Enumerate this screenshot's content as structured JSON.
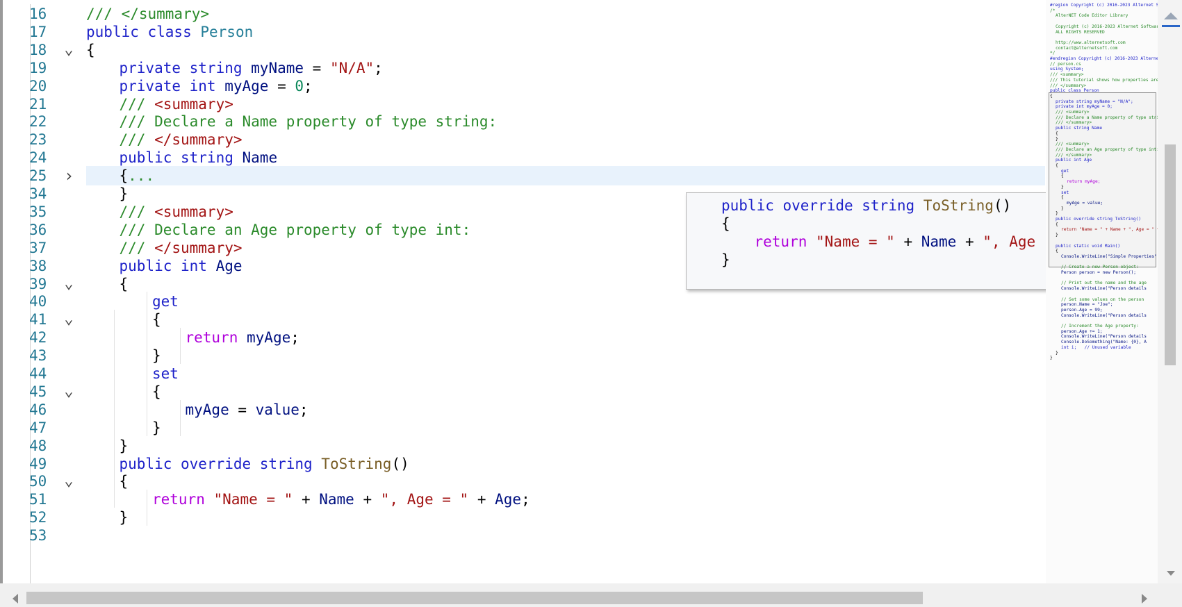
{
  "editor": {
    "lines": [
      {
        "num": "16",
        "fold": "",
        "indent": 0,
        "tokens": [
          {
            "t": "/// </summary>",
            "c": "cm"
          }
        ]
      },
      {
        "num": "17",
        "fold": "",
        "indent": 0,
        "tokens": [
          {
            "t": "public class ",
            "c": "kw"
          },
          {
            "t": "Person",
            "c": "ty"
          }
        ]
      },
      {
        "num": "18",
        "fold": "v",
        "indent": 0,
        "tokens": [
          {
            "t": "{",
            "c": "plain"
          }
        ]
      },
      {
        "num": "19",
        "fold": "",
        "indent": 1,
        "tokens": [
          {
            "t": "private string ",
            "c": "kw"
          },
          {
            "t": "myName",
            "c": "id"
          },
          {
            "t": " = ",
            "c": "plain"
          },
          {
            "t": "\"N/A\"",
            "c": "str"
          },
          {
            "t": ";",
            "c": "plain"
          }
        ]
      },
      {
        "num": "20",
        "fold": "",
        "indent": 1,
        "tokens": [
          {
            "t": "private int ",
            "c": "kw"
          },
          {
            "t": "myAge",
            "c": "id"
          },
          {
            "t": " = ",
            "c": "plain"
          },
          {
            "t": "0",
            "c": "num"
          },
          {
            "t": ";",
            "c": "plain"
          }
        ]
      },
      {
        "num": "21",
        "fold": "",
        "indent": 1,
        "tokens": [
          {
            "t": "/// ",
            "c": "cm"
          },
          {
            "t": "<summary>",
            "c": "str"
          }
        ]
      },
      {
        "num": "22",
        "fold": "",
        "indent": 1,
        "tokens": [
          {
            "t": "/// Declare a Name property of type string:",
            "c": "cm"
          }
        ]
      },
      {
        "num": "23",
        "fold": "",
        "indent": 1,
        "tokens": [
          {
            "t": "/// ",
            "c": "cm"
          },
          {
            "t": "</summary>",
            "c": "str"
          }
        ]
      },
      {
        "num": "24",
        "fold": "",
        "indent": 1,
        "tokens": [
          {
            "t": "public string ",
            "c": "kw"
          },
          {
            "t": "Name",
            "c": "id"
          }
        ]
      },
      {
        "num": "25",
        "fold": ">",
        "indent": 1,
        "highlight": true,
        "tokens": [
          {
            "t": "{",
            "c": "plain"
          },
          {
            "t": "...",
            "c": "cm"
          }
        ]
      },
      {
        "num": "34",
        "fold": "",
        "indent": 1,
        "tokens": [
          {
            "t": "}",
            "c": "plain"
          }
        ]
      },
      {
        "num": "35",
        "fold": "",
        "indent": 1,
        "tokens": [
          {
            "t": "/// ",
            "c": "cm"
          },
          {
            "t": "<summary>",
            "c": "str"
          }
        ]
      },
      {
        "num": "36",
        "fold": "",
        "indent": 1,
        "tokens": [
          {
            "t": "/// Declare an Age property of type int:",
            "c": "cm"
          }
        ]
      },
      {
        "num": "37",
        "fold": "",
        "indent": 1,
        "tokens": [
          {
            "t": "/// ",
            "c": "cm"
          },
          {
            "t": "</summary>",
            "c": "str"
          }
        ]
      },
      {
        "num": "38",
        "fold": "",
        "indent": 1,
        "tokens": [
          {
            "t": "public int ",
            "c": "kw"
          },
          {
            "t": "Age",
            "c": "id"
          }
        ]
      },
      {
        "num": "39",
        "fold": "v",
        "indent": 1,
        "tokens": [
          {
            "t": "{",
            "c": "plain"
          }
        ]
      },
      {
        "num": "40",
        "fold": "",
        "indent": 2,
        "tokens": [
          {
            "t": "get",
            "c": "kw"
          }
        ]
      },
      {
        "num": "41",
        "fold": "v",
        "indent": 2,
        "tokens": [
          {
            "t": "{",
            "c": "plain"
          }
        ]
      },
      {
        "num": "42",
        "fold": "",
        "indent": 3,
        "tokens": [
          {
            "t": "return ",
            "c": "ctl"
          },
          {
            "t": "myAge",
            "c": "id"
          },
          {
            "t": ";",
            "c": "plain"
          }
        ]
      },
      {
        "num": "43",
        "fold": "",
        "indent": 2,
        "tokens": [
          {
            "t": "}",
            "c": "plain"
          }
        ]
      },
      {
        "num": "44",
        "fold": "",
        "indent": 2,
        "tokens": [
          {
            "t": "set",
            "c": "kw"
          }
        ]
      },
      {
        "num": "45",
        "fold": "v",
        "indent": 2,
        "tokens": [
          {
            "t": "{",
            "c": "plain"
          }
        ]
      },
      {
        "num": "46",
        "fold": "",
        "indent": 3,
        "tokens": [
          {
            "t": "myAge",
            "c": "id"
          },
          {
            "t": " = ",
            "c": "plain"
          },
          {
            "t": "value",
            "c": "id"
          },
          {
            "t": ";",
            "c": "plain"
          }
        ]
      },
      {
        "num": "47",
        "fold": "",
        "indent": 2,
        "tokens": [
          {
            "t": "}",
            "c": "plain"
          }
        ]
      },
      {
        "num": "48",
        "fold": "",
        "indent": 1,
        "tokens": [
          {
            "t": "}",
            "c": "plain"
          }
        ]
      },
      {
        "num": "49",
        "fold": "",
        "indent": 1,
        "tokens": [
          {
            "t": "public override string ",
            "c": "kw"
          },
          {
            "t": "ToString",
            "c": "fn"
          },
          {
            "t": "()",
            "c": "plain"
          }
        ]
      },
      {
        "num": "50",
        "fold": "v",
        "indent": 1,
        "tokens": [
          {
            "t": "{",
            "c": "plain"
          }
        ]
      },
      {
        "num": "51",
        "fold": "",
        "indent": 2,
        "tokens": [
          {
            "t": "return ",
            "c": "ctl"
          },
          {
            "t": "\"Name = \"",
            "c": "str"
          },
          {
            "t": " + ",
            "c": "plain"
          },
          {
            "t": "Name",
            "c": "id"
          },
          {
            "t": " + ",
            "c": "plain"
          },
          {
            "t": "\", Age = \"",
            "c": "str"
          },
          {
            "t": " + ",
            "c": "plain"
          },
          {
            "t": "Age",
            "c": "id"
          },
          {
            "t": ";",
            "c": "plain"
          }
        ]
      },
      {
        "num": "52",
        "fold": "",
        "indent": 1,
        "tokens": [
          {
            "t": "}",
            "c": "plain"
          }
        ]
      },
      {
        "num": "53",
        "fold": "",
        "indent": 0,
        "tokens": []
      }
    ]
  },
  "tooltip": {
    "lines": [
      {
        "indent": 0,
        "tokens": [
          {
            "t": "public override string ",
            "c": "kw"
          },
          {
            "t": "ToString",
            "c": "fn"
          },
          {
            "t": "()",
            "c": "plain"
          }
        ]
      },
      {
        "indent": 0,
        "tokens": [
          {
            "t": "{",
            "c": "plain"
          }
        ]
      },
      {
        "indent": 1,
        "tokens": [
          {
            "t": "return ",
            "c": "ctl"
          },
          {
            "t": "\"Name = \"",
            "c": "str"
          },
          {
            "t": " + ",
            "c": "plain"
          },
          {
            "t": "Name",
            "c": "id"
          },
          {
            "t": " + ",
            "c": "plain"
          },
          {
            "t": "\", Age",
            "c": "str"
          }
        ]
      },
      {
        "indent": 0,
        "tokens": [
          {
            "t": "}",
            "c": "plain"
          }
        ]
      }
    ]
  },
  "minimap": {
    "lines": [
      {
        "i": 0,
        "c": "kw",
        "t": "#region Copyright (c) 2016-2023 Alternet Software"
      },
      {
        "i": 0,
        "c": "cm",
        "t": "/*"
      },
      {
        "i": 2,
        "c": "cm",
        "t": "AlterNET Code Editor Library"
      },
      {
        "i": 0,
        "c": "cm",
        "t": ""
      },
      {
        "i": 2,
        "c": "cm",
        "t": "Copyright (c) 2016-2023 Alternet Software"
      },
      {
        "i": 2,
        "c": "cm",
        "t": "ALL RIGHTS RESERVED"
      },
      {
        "i": 0,
        "c": "cm",
        "t": ""
      },
      {
        "i": 2,
        "c": "cm",
        "t": "http://www.alternetsoft.com"
      },
      {
        "i": 2,
        "c": "cm",
        "t": "contact@alternetsoft.com"
      },
      {
        "i": 0,
        "c": "cm",
        "t": "*/"
      },
      {
        "i": 0,
        "c": "kw",
        "t": "#endregion Copyright (c) 2016-2023 Alternet Software"
      },
      {
        "i": 0,
        "c": "cm",
        "t": "// person.cs"
      },
      {
        "i": 0,
        "c": "kw",
        "t": "using System;"
      },
      {
        "i": 0,
        "c": "cm",
        "t": "/// <summary>"
      },
      {
        "i": 0,
        "c": "cm",
        "t": "/// This tutorial shows how properties are"
      },
      {
        "i": 0,
        "c": "cm",
        "t": "/// </summary>"
      },
      {
        "i": 0,
        "c": "kw",
        "t": "public class Person"
      },
      {
        "i": 0,
        "c": "plain",
        "t": "{"
      },
      {
        "i": 2,
        "c": "kw",
        "t": "private string myName = \"N/A\";"
      },
      {
        "i": 2,
        "c": "kw",
        "t": "private int myAge = 0;"
      },
      {
        "i": 2,
        "c": "cm",
        "t": "/// <summary>"
      },
      {
        "i": 2,
        "c": "cm",
        "t": "/// Declare a Name property of type string:"
      },
      {
        "i": 2,
        "c": "cm",
        "t": "/// </summary>"
      },
      {
        "i": 2,
        "c": "kw",
        "t": "public string Name"
      },
      {
        "i": 2,
        "c": "plain",
        "t": "{"
      },
      {
        "i": 2,
        "c": "plain",
        "t": "}"
      },
      {
        "i": 2,
        "c": "cm",
        "t": "/// <summary>"
      },
      {
        "i": 2,
        "c": "cm",
        "t": "/// Declare an Age property of type int:"
      },
      {
        "i": 2,
        "c": "cm",
        "t": "/// </summary>"
      },
      {
        "i": 2,
        "c": "kw",
        "t": "public int Age"
      },
      {
        "i": 2,
        "c": "plain",
        "t": "{"
      },
      {
        "i": 4,
        "c": "kw",
        "t": "get"
      },
      {
        "i": 4,
        "c": "plain",
        "t": "{"
      },
      {
        "i": 6,
        "c": "ctl",
        "t": "return myAge;"
      },
      {
        "i": 4,
        "c": "plain",
        "t": "}"
      },
      {
        "i": 4,
        "c": "kw",
        "t": "set"
      },
      {
        "i": 4,
        "c": "plain",
        "t": "{"
      },
      {
        "i": 6,
        "c": "id",
        "t": "myAge = value;"
      },
      {
        "i": 4,
        "c": "plain",
        "t": "}"
      },
      {
        "i": 2,
        "c": "plain",
        "t": "}"
      },
      {
        "i": 2,
        "c": "kw",
        "t": "public override string ToString()"
      },
      {
        "i": 2,
        "c": "plain",
        "t": "{"
      },
      {
        "i": 4,
        "c": "str",
        "t": "return \"Name = \" + Name + \", Age = \" + Age;"
      },
      {
        "i": 2,
        "c": "plain",
        "t": "}"
      },
      {
        "i": 0,
        "c": "plain",
        "t": ""
      },
      {
        "i": 2,
        "c": "kw",
        "t": "public static void Main()"
      },
      {
        "i": 2,
        "c": "plain",
        "t": "{"
      },
      {
        "i": 4,
        "c": "id",
        "t": "Console.WriteLine(\"Simple Properties\");"
      },
      {
        "i": 0,
        "c": "plain",
        "t": ""
      },
      {
        "i": 4,
        "c": "cm",
        "t": "// Create a new Person object:"
      },
      {
        "i": 4,
        "c": "id",
        "t": "Person person = new Person();"
      },
      {
        "i": 0,
        "c": "plain",
        "t": ""
      },
      {
        "i": 4,
        "c": "cm",
        "t": "// Print out the name and the age"
      },
      {
        "i": 4,
        "c": "id",
        "t": "Console.WriteLine(\"Person details"
      },
      {
        "i": 0,
        "c": "plain",
        "t": ""
      },
      {
        "i": 4,
        "c": "cm",
        "t": "// Set some values on the person"
      },
      {
        "i": 4,
        "c": "id",
        "t": "person.Name = \"Joe\";"
      },
      {
        "i": 4,
        "c": "id",
        "t": "person.Age = 99;"
      },
      {
        "i": 4,
        "c": "id",
        "t": "Console.WriteLine(\"Person details"
      },
      {
        "i": 0,
        "c": "plain",
        "t": ""
      },
      {
        "i": 4,
        "c": "cm",
        "t": "// Increment the Age property:"
      },
      {
        "i": 4,
        "c": "id",
        "t": "person.Age += 1;"
      },
      {
        "i": 4,
        "c": "id",
        "t": "Console.WriteLine(\"Person details"
      },
      {
        "i": 4,
        "c": "id",
        "t": "Console.DoSomething(\"Name: {0}, A"
      },
      {
        "i": 4,
        "c": "kw",
        "t": "int i;   // Unused variable"
      },
      {
        "i": 2,
        "c": "plain",
        "t": "}"
      },
      {
        "i": 0,
        "c": "plain",
        "t": "}"
      }
    ]
  },
  "icons": {
    "fold_expanded": "chevron-down-icon",
    "fold_collapsed": "chevron-right-icon",
    "scroll_up": "arrow-up-icon",
    "scroll_down": "arrow-down-icon",
    "scroll_left": "arrow-left-icon",
    "scroll_right": "arrow-right-icon"
  },
  "colors": {
    "keyword": "#1e22c9",
    "type": "#267f99",
    "comment": "#2a8a2a",
    "string": "#a31515",
    "number": "#098658",
    "method": "#795e26",
    "control": "#af00db",
    "identifier": "#001080",
    "line_number": "#237893",
    "current_line": "#e8f2fc"
  }
}
